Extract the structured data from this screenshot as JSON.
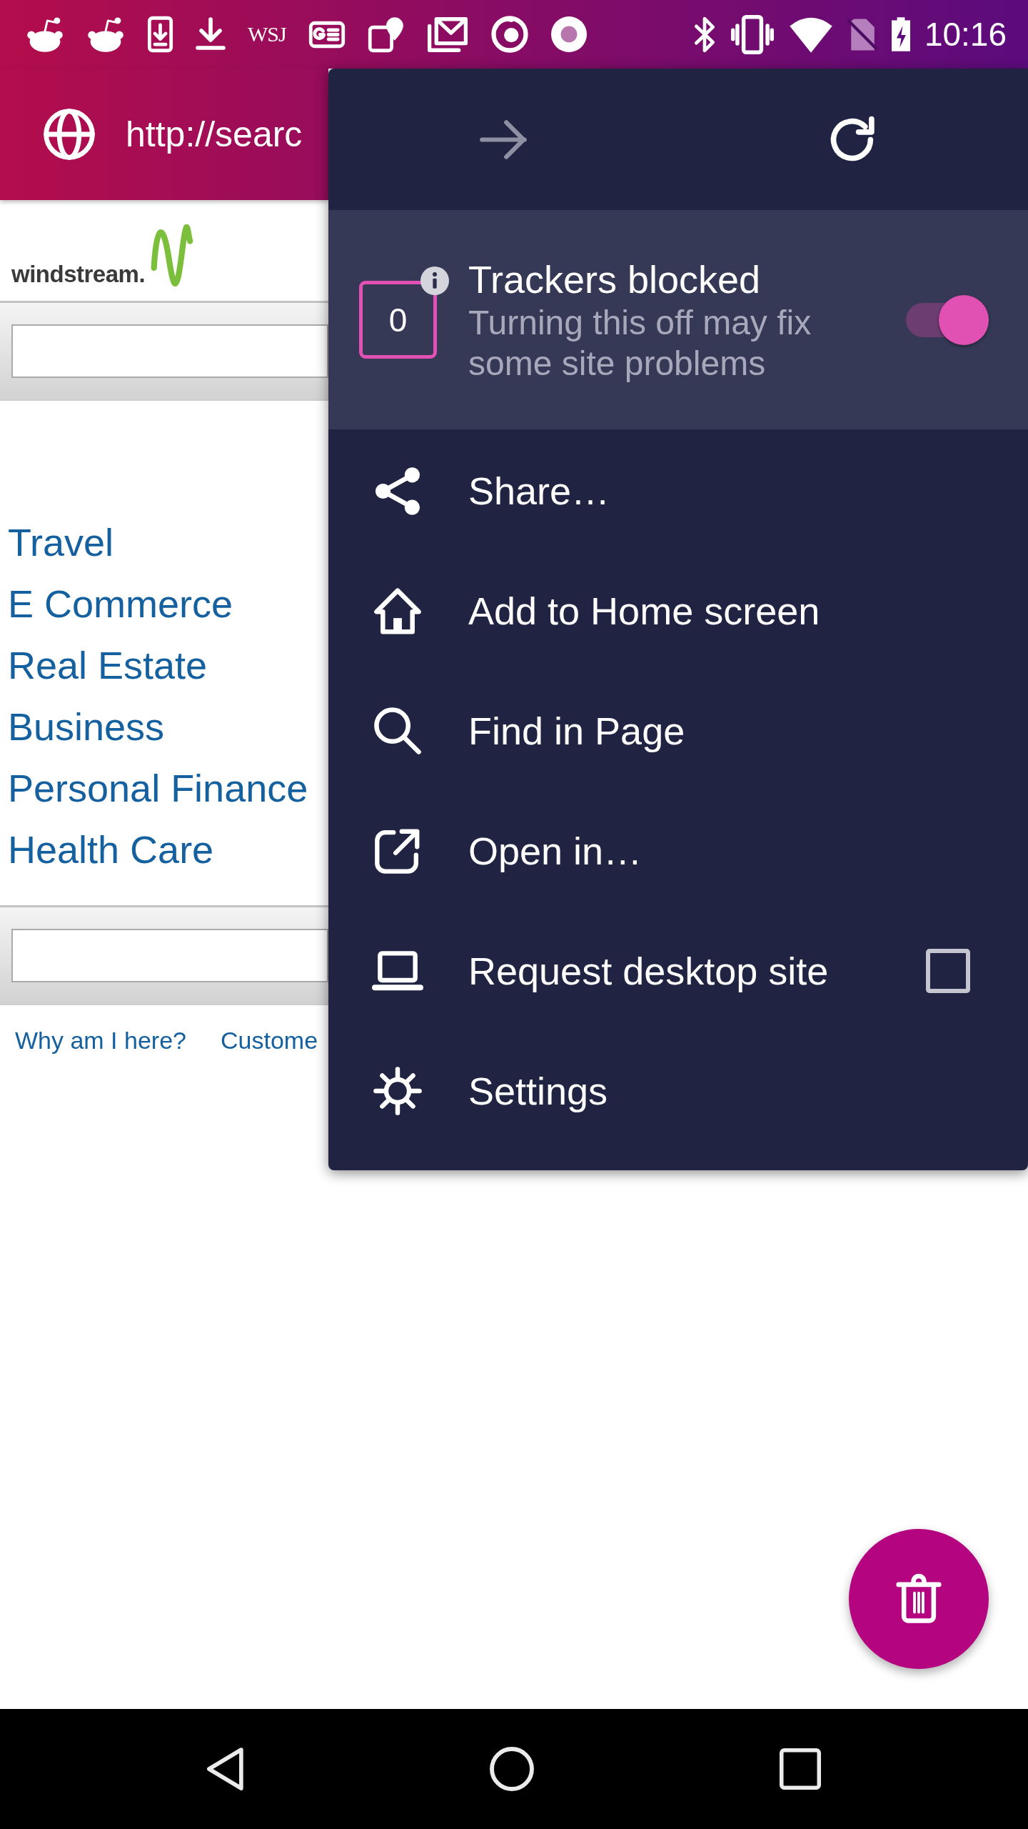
{
  "status_bar": {
    "notification_label": "WSJ",
    "time": "10:16"
  },
  "address_bar": {
    "url": "http://searc"
  },
  "page": {
    "logo_text": "windstream.",
    "links": [
      "Travel",
      "E Commerce",
      "Real Estate",
      "Business",
      "Personal Finance",
      "Health Care"
    ],
    "footer_links": [
      "Why am I here?",
      "Custome"
    ]
  },
  "menu": {
    "nav": [
      {
        "disabled": true
      },
      {
        "disabled": false
      }
    ],
    "tracking": {
      "count": "0",
      "title": "Trackers blocked",
      "subtitle": "Turning this off may fix some site problems",
      "on": true
    },
    "items": [
      {
        "kind": "action",
        "label": "Share…"
      },
      {
        "kind": "action",
        "label": "Add to Home screen"
      },
      {
        "kind": "action",
        "label": "Find in Page"
      },
      {
        "kind": "action",
        "label": "Open in…"
      },
      {
        "kind": "checkbox",
        "label": "Request desktop site",
        "checked": false
      },
      {
        "kind": "action",
        "label": "Settings"
      }
    ]
  }
}
